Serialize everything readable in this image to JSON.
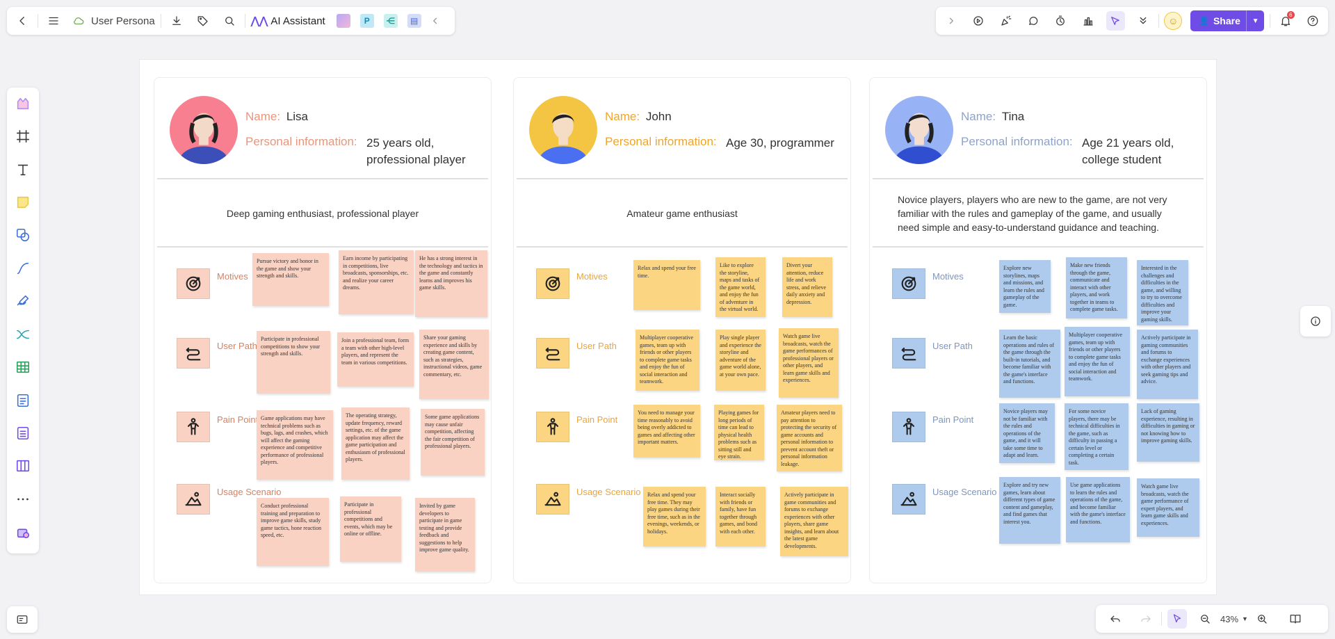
{
  "toolbar": {
    "doc_title": "User Persona",
    "ai_label": "AI Assistant",
    "share_label": "Share",
    "notif_count": "6"
  },
  "bottom": {
    "zoom": "43%"
  },
  "colors": {
    "lisa": "#f9d2c3",
    "john": "#fcd582",
    "tina": "#aecbed",
    "brand": "#6f4ce6"
  },
  "personas": [
    {
      "name_key": "Name:",
      "name": "Lisa",
      "info_key": "Personal information:",
      "info_lines": [
        "25 years old,",
        "professional player"
      ],
      "desc": "Deep gaming enthusiast, professional player",
      "motives_label": "Motives",
      "path_label": "User Path",
      "pain_label": "Pain Point",
      "usage_label": "Usage Scenario",
      "motives": [
        "Pursue victory and honor in the game and show your strength and skills.",
        "Earn income by participating in competitions, live broadcasts, sponsorships, etc. and realize your career dreams.",
        "He has a strong interest in the technology and tactics in the game and constantly learns and improves his game skills."
      ],
      "path": [
        "Participate in professional competitions to show your strength and skills.",
        "Join a professional team, form a team with other high-level players, and represent the team in various competitions.",
        "Share your gaming experience and skills by creating game content, such as strategies, instructional videos, game commentary, etc."
      ],
      "pain": [
        "Game applications may have technical problems such as bugs, lags, and crashes, which will affect the gaming experience and competitive performance of professional players.",
        "The operating strategy, update frequency, reward settings, etc. of the game application may affect the game participation and enthusiasm of professional players.",
        "Some game applications may cause unfair competition, affecting the fair competition of professional players."
      ],
      "usage": [
        "Conduct professional training and preparation to improve game skills, study game tactics, hone reaction speed, etc.",
        "Participate in professional competitions and events, which may be online or offline.",
        "Invited by game developers to participate in game testing and provide feedback and suggestions to help improve game quality."
      ]
    },
    {
      "name_key": "Name:",
      "name": "John",
      "info_key": "Personal information:",
      "info_lines": [
        "Age 30, programmer"
      ],
      "desc": "Amateur game enthusiast",
      "motives_label": "Motives",
      "path_label": "User Path",
      "pain_label": "Pain Point",
      "usage_label": "Usage Scenario",
      "motives": [
        "Relax and spend your free time.",
        "Like to explore the storyline, maps and tasks of the game world, and enjoy the fun of adventure in the virtual world.",
        "Divert your attention, reduce life and work stress, and relieve daily anxiety and depression."
      ],
      "path": [
        "Multiplayer cooperative games, team up with friends or other players to complete game tasks and enjoy the fun of social interaction and teamwork.",
        "Play single player and experience the storyline and adventure of the game world alone, at your own pace.",
        "Watch game live broadcasts, watch the game performances of professional players or other players, and learn game skills and experiences."
      ],
      "pain": [
        "You need to manage your time reasonably to avoid being overly addicted to games and affecting other important matters.",
        "Playing games for long periods of time can lead to physical health problems such as sitting still and eye strain.",
        "Amateur players need to pay attention to protecting the security of game accounts and personal information to prevent account theft or personal information leakage."
      ],
      "usage": [
        "Relax and spend your free time. They may play games during their free time, such as in the evenings, weekends, or holidays.",
        "Interact socially with friends or family, have fun together through games, and bond with each other.",
        "Actively participate in game communities and forums to exchange experiences with other players, share game insights, and learn about the latest game developments."
      ]
    },
    {
      "name_key": "Name:",
      "name": "Tina",
      "info_key": "Personal information:",
      "info_lines": [
        "Age 21 years old,",
        "college student"
      ],
      "desc": "Novice players, players who are new to the game, are not very familiar with the rules and gameplay of the game, and usually need simple and easy-to-understand guidance and teaching.",
      "motives_label": "Motives",
      "path_label": "User Path",
      "pain_label": "Pain Point",
      "usage_label": "Usage Scenario",
      "motives": [
        "Explore new storylines, maps and missions, and learn the rules and gameplay of the game.",
        "Make new friends through the game, communicate and interact with other players, and work together in teams to complete game tasks.",
        "Interested in the challenges and difficulties in the game, and willing to try to overcome difficulties and improve your gaming skills."
      ],
      "path": [
        "Learn the basic operations and rules of the game through the built-in tutorials, and become familiar with the game's interface and functions.",
        "Multiplayer cooperative games, team up with friends or other players to complete game tasks and enjoy the fun of social interaction and teamwork.",
        "Actively participate in gaming communities and forums to exchange experiences with other players and seek gaming tips and advice."
      ],
      "pain": [
        "Novice players may not be familiar with the rules and operations of the game, and it will take some time to adapt and learn.",
        "For some novice players, there may be technical difficulties in the game, such as difficulty in passing a certain level or completing a certain task.",
        "Lack of gaming experience, resulting in difficulties in gaming or not knowing how to improve gaming skills."
      ],
      "usage": [
        "Explore and try new games, learn about different types of game content and gameplay, and find games that interest you.",
        "Use game applications to learn the rules and operations of the game, and become familiar with the game's interface and functions.",
        "Watch game live broadcasts, watch the game performance of expert players, and learn game skills and experiences."
      ]
    }
  ]
}
